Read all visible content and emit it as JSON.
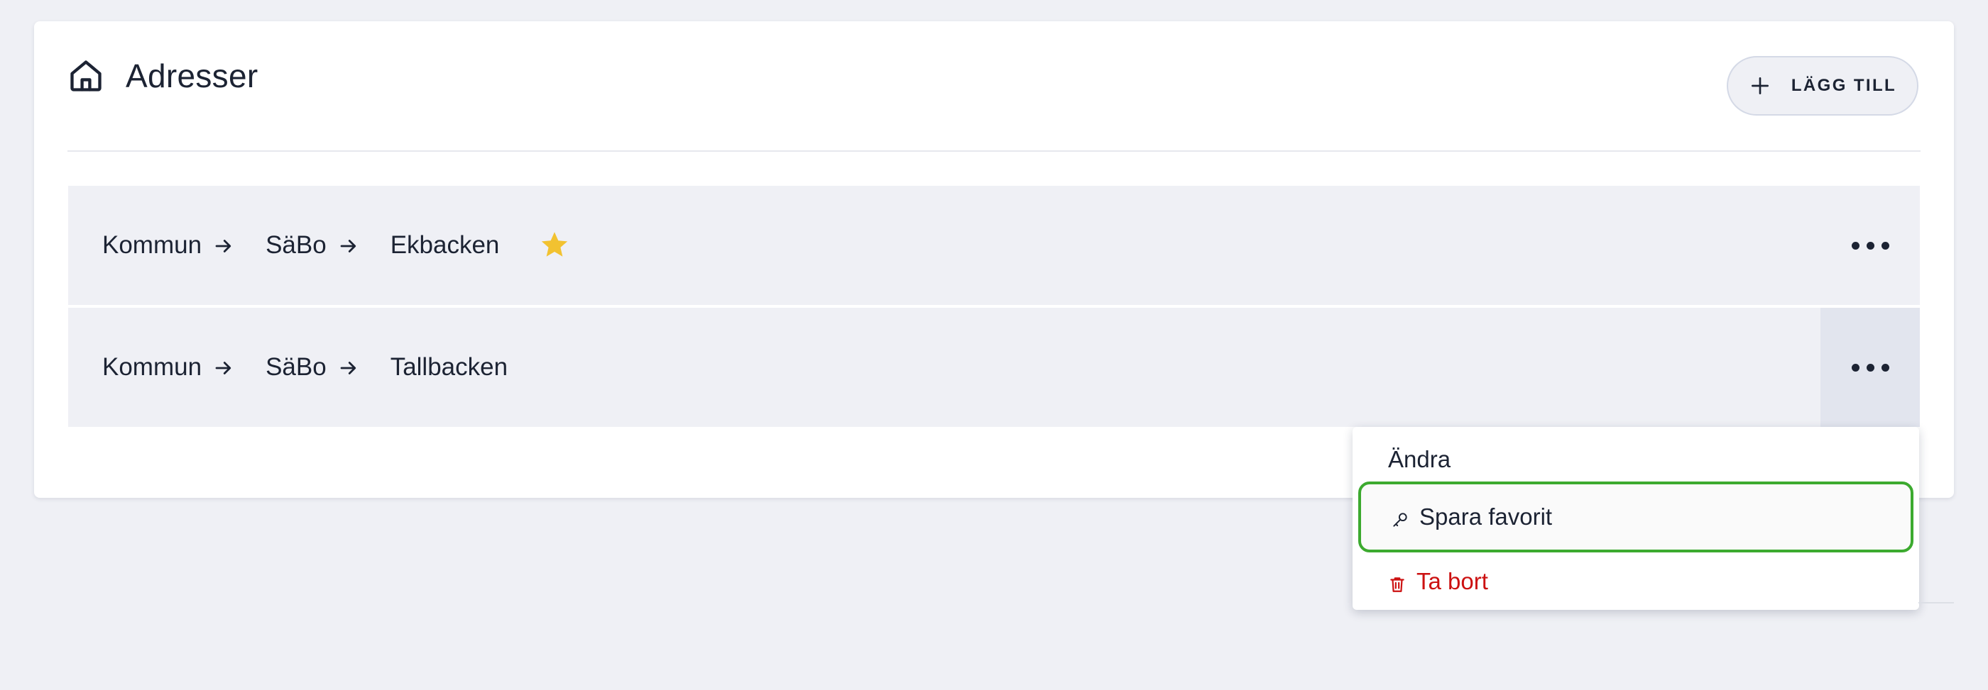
{
  "page": {
    "title": "Adresser",
    "add_button_label": "LÄGG TILL"
  },
  "addresses": [
    {
      "parts": [
        "Kommun",
        "SäBo",
        "Ekbacken"
      ],
      "favorite": true
    },
    {
      "parts": [
        "Kommun",
        "SäBo",
        "Tallbacken"
      ],
      "favorite": false
    }
  ],
  "context_menu": {
    "edit_label": "Ändra",
    "favorite_label": "Spara favorit",
    "delete_label": "Ta bort"
  },
  "colors": {
    "background": "#eff0f5",
    "star": "#f2c230",
    "delete": "#cc1111",
    "focus_ring": "#3caa2f"
  },
  "icons": [
    "home-icon",
    "plus-icon",
    "arrow-right-icon",
    "star-icon",
    "more-dots-icon",
    "key-icon",
    "trash-icon"
  ]
}
